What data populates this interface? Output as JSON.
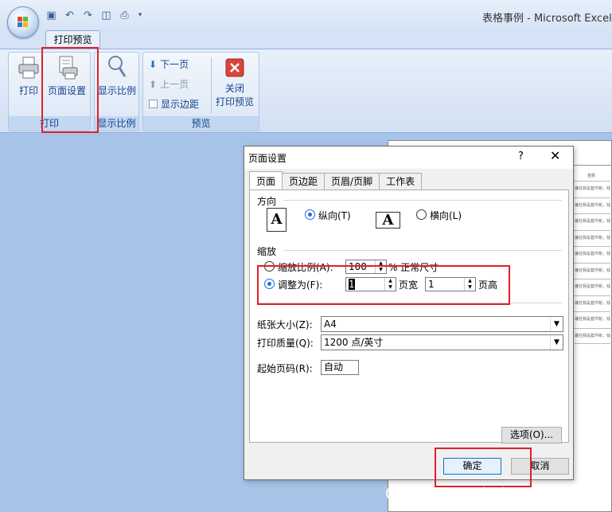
{
  "window": {
    "title": "表格事例 - Microsoft Excel"
  },
  "ribbon": {
    "active_tab": "打印预览",
    "groups": {
      "print": {
        "label": "打印",
        "print_btn": "打印",
        "page_setup_btn": "页面设置"
      },
      "zoom": {
        "label": "显示比例",
        "zoom_btn": "显示比例"
      },
      "preview": {
        "label": "预览",
        "next_page": "下一页",
        "prev_page": "上一页",
        "show_margins": "显示边距",
        "close_line1": "关闭",
        "close_line2": "打印预览"
      }
    }
  },
  "preview_page": {
    "col_header": "金额",
    "row_text": "编任我是套件帐，钱"
  },
  "dialog": {
    "title": "页面设置",
    "help": "?",
    "close": "✕",
    "tabs": [
      "页面",
      "页边距",
      "页眉/页脚",
      "工作表"
    ],
    "orientation": {
      "label": "方向",
      "portrait": "纵向(T)",
      "landscape": "横向(L)",
      "icon_letter": "A"
    },
    "scaling": {
      "label": "缩放",
      "adjust_to_label": "缩放比例(A):",
      "adjust_to_value": "100",
      "adjust_suffix": "% 正常尺寸",
      "fit_to_label": "调整为(F):",
      "pages_wide_value": "1",
      "pages_wide_label": "页宽",
      "pages_tall_value": "1",
      "pages_tall_label": "页高"
    },
    "paper_size": {
      "label": "纸张大小(Z):",
      "value": "A4"
    },
    "print_quality": {
      "label": "打印质量(Q):",
      "value": "1200 点/英寸"
    },
    "first_page": {
      "label": "起始页码(R):",
      "value": "自动"
    },
    "options_btn": "选项(O)...",
    "ok_btn": "确定",
    "cancel_btn": "取消"
  },
  "watermark": "CSDN @statistics+insight",
  "colors": {
    "highlight": "#e0202a",
    "accent": "#1e6fd9"
  }
}
